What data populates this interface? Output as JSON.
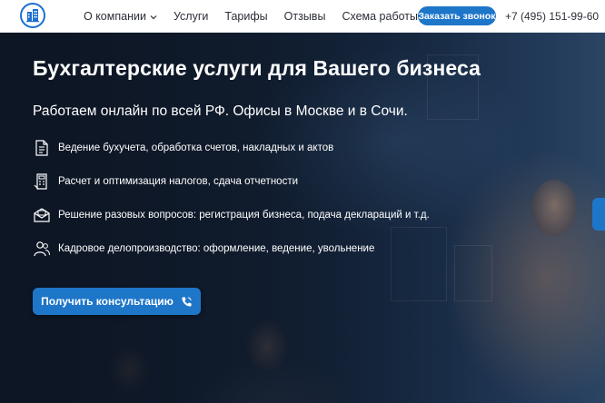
{
  "header": {
    "nav": [
      {
        "label": "О компании",
        "has_dropdown": true
      },
      {
        "label": "Услуги"
      },
      {
        "label": "Тарифы"
      },
      {
        "label": "Отзывы"
      },
      {
        "label": "Схема работы"
      }
    ],
    "call_button": "Заказать звонок",
    "phone": "+7 (495) 151-99-60"
  },
  "hero": {
    "title": "Бухгалтерские услуги для Вашего бизнеса",
    "subtitle": "Работаем онлайн по всей РФ. Офисы в Москве и в Сочи.",
    "features": [
      {
        "icon": "document-list-icon",
        "text": "Ведение бухучета, обработка счетов, накладных и актов"
      },
      {
        "icon": "calculator-document-icon",
        "text": "Расчет и оптимизация налогов, сдача отчетности"
      },
      {
        "icon": "envelope-document-icon",
        "text": "Решение разовых вопросов: регистрация бизнеса, подача деклараций и т.д."
      },
      {
        "icon": "people-icon",
        "text": "Кадровое делопроизводство: оформление, ведение, увольнение"
      }
    ],
    "cta_label": "Получить консультацию"
  },
  "colors": {
    "accent": "#1e76c9",
    "header_bg": "#ffffff",
    "text_dark": "#2b2f36"
  }
}
